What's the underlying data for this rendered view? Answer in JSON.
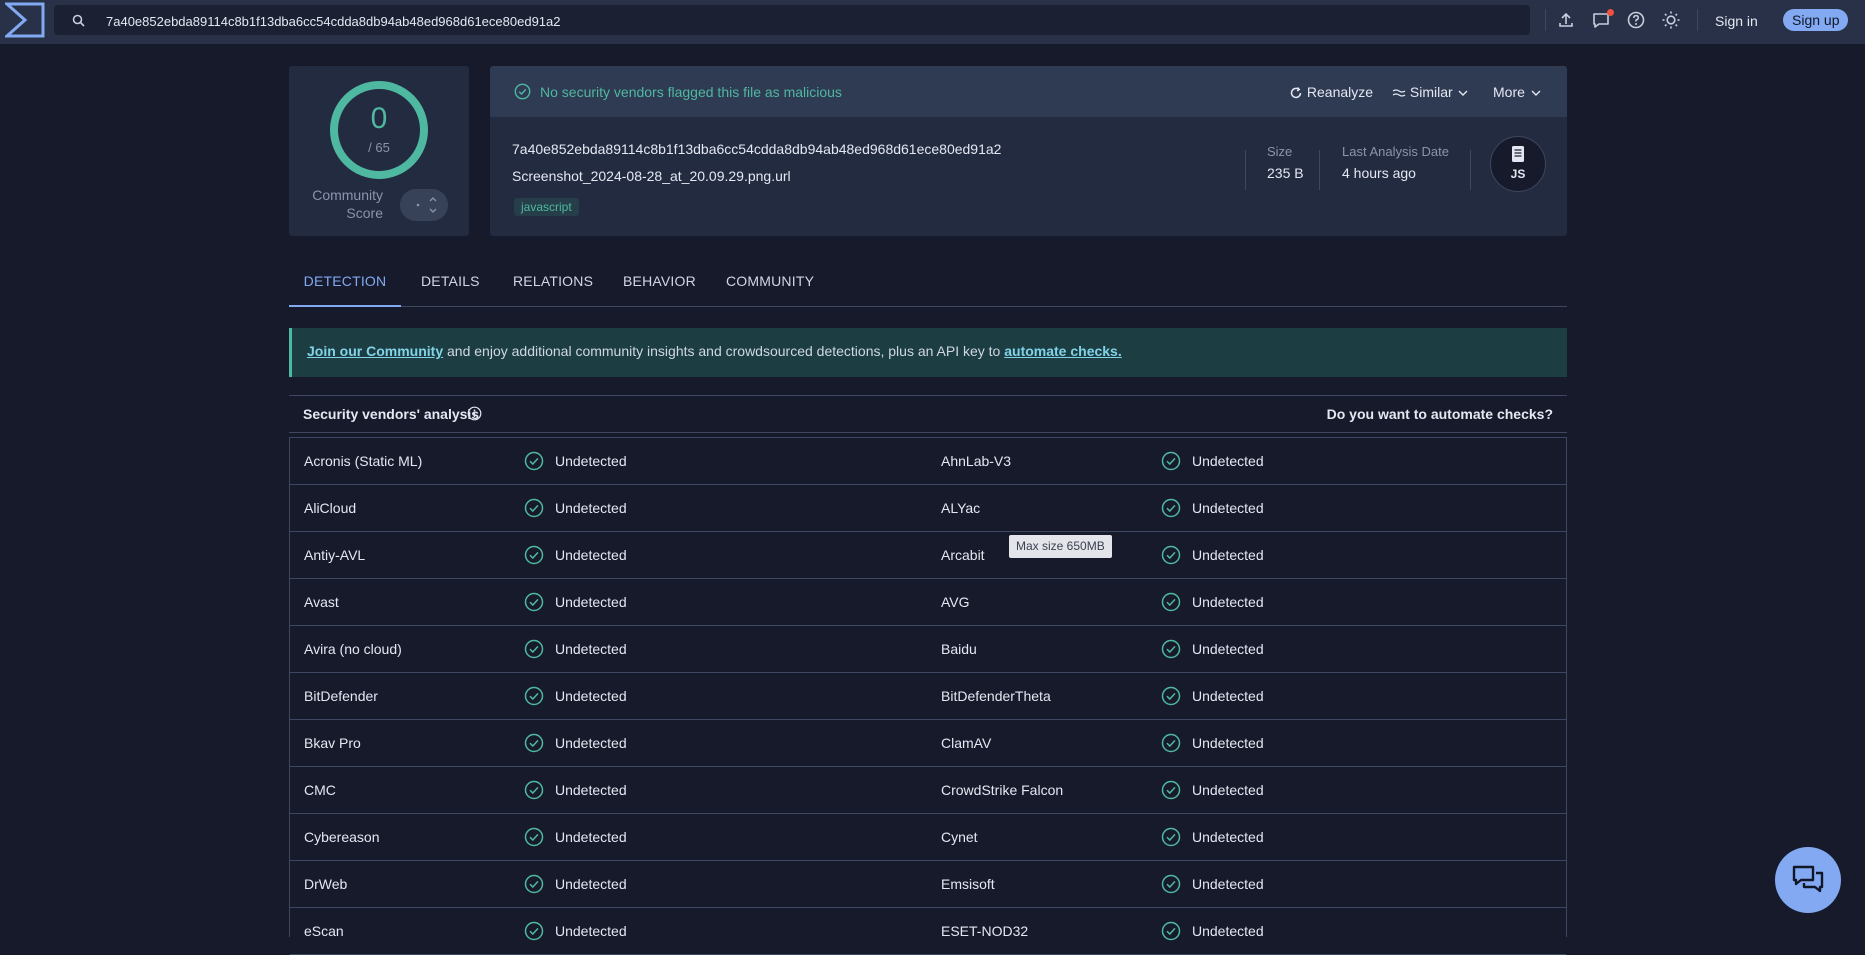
{
  "topbar": {
    "search_value": "7a40e852ebda89114c8b1f13dba6cc54cdda8db94ab48ed968d61ece80ed91a2",
    "sign_in": "Sign in",
    "sign_up": "Sign up",
    "icons": [
      "upload-icon",
      "messages-icon",
      "help-icon",
      "theme-toggle-icon"
    ]
  },
  "score": {
    "value": "0",
    "total": "/ 65",
    "community_label_1": "Community",
    "community_label_2": "Score"
  },
  "info": {
    "status": "No security vendors flagged this file as malicious",
    "reanalyze": "Reanalyze",
    "similar": "Similar",
    "more": "More",
    "hash": "7a40e852ebda89114c8b1f13dba6cc54cdda8db94ab48ed968d61ece80ed91a2",
    "filename": "Screenshot_2024-08-28_at_20.09.29.png.url",
    "tag": "javascript",
    "size_label": "Size",
    "size_value": "235 B",
    "date_label": "Last Analysis Date",
    "date_value": "4 hours ago",
    "filetype": "JS"
  },
  "tabs": [
    "DETECTION",
    "DETAILS",
    "RELATIONS",
    "BEHAVIOR",
    "COMMUNITY"
  ],
  "banner": {
    "link1": "Join our Community",
    "middle": " and enjoy additional community insights and crowdsourced detections, plus an API key to ",
    "link2": "automate checks."
  },
  "vendors": {
    "title": "Security vendors' analysis",
    "automate": "Do you want to automate checks?",
    "rows": [
      [
        {
          "name": "Acronis (Static ML)",
          "result": "Undetected"
        },
        {
          "name": "AhnLab-V3",
          "result": "Undetected"
        }
      ],
      [
        {
          "name": "AliCloud",
          "result": "Undetected"
        },
        {
          "name": "ALYac",
          "result": "Undetected"
        }
      ],
      [
        {
          "name": "Antiy-AVL",
          "result": "Undetected"
        },
        {
          "name": "Arcabit",
          "result": "Undetected"
        }
      ],
      [
        {
          "name": "Avast",
          "result": "Undetected"
        },
        {
          "name": "AVG",
          "result": "Undetected"
        }
      ],
      [
        {
          "name": "Avira (no cloud)",
          "result": "Undetected"
        },
        {
          "name": "Baidu",
          "result": "Undetected"
        }
      ],
      [
        {
          "name": "BitDefender",
          "result": "Undetected"
        },
        {
          "name": "BitDefenderTheta",
          "result": "Undetected"
        }
      ],
      [
        {
          "name": "Bkav Pro",
          "result": "Undetected"
        },
        {
          "name": "ClamAV",
          "result": "Undetected"
        }
      ],
      [
        {
          "name": "CMC",
          "result": "Undetected"
        },
        {
          "name": "CrowdStrike Falcon",
          "result": "Undetected"
        }
      ],
      [
        {
          "name": "Cybereason",
          "result": "Undetected"
        },
        {
          "name": "Cynet",
          "result": "Undetected"
        }
      ],
      [
        {
          "name": "DrWeb",
          "result": "Undetected"
        },
        {
          "name": "Emsisoft",
          "result": "Undetected"
        }
      ],
      [
        {
          "name": "eScan",
          "result": "Undetected"
        },
        {
          "name": "ESET-NOD32",
          "result": "Undetected"
        }
      ]
    ]
  },
  "tooltip": "Max size 650MB",
  "colors": {
    "background": "#161a2b",
    "accent": "#82a9f2",
    "clean": "#4fb8a0"
  }
}
